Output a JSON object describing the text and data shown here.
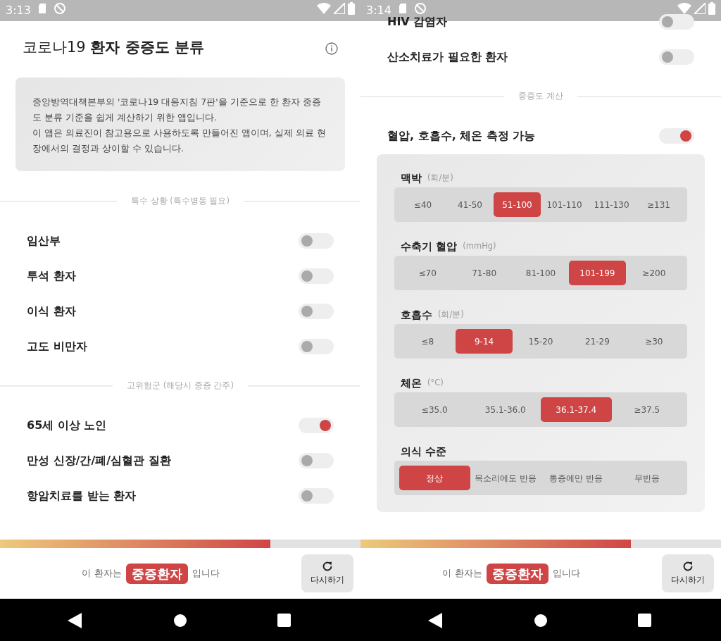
{
  "screens": [
    {
      "status_bar": {
        "time": "3:13"
      },
      "title": "코로나19 **환자 중증도 분류**",
      "notice": [
        "중앙방역대책본부의 '코로나19 대응지침 7판'을 기준으로 한 환자 중증도 분류 기준을 쉽게 계산하기 위한 앱입니다.",
        "이 앱은 의료진이 참고용으로 사용하도록 만들어진 앱이며, 실제 의료 현장에서의 결정과 상이할 수 있습니다."
      ],
      "sections": [
        {
          "kind": "divider",
          "label": "특수 상황 (특수병동 필요)"
        },
        {
          "kind": "toggle",
          "label": "임산부",
          "on": false
        },
        {
          "kind": "toggle",
          "label": "투석 환자",
          "on": false
        },
        {
          "kind": "toggle",
          "label": "이식 환자",
          "on": false
        },
        {
          "kind": "toggle",
          "label": "고도 비만자",
          "on": false
        },
        {
          "kind": "divider",
          "label": "고위험군 (해당시 중증 간주)"
        },
        {
          "kind": "toggle",
          "label": "65세 이상 노인",
          "on": true
        },
        {
          "kind": "toggle",
          "label": "만성 신장/간/폐/심혈관 질환",
          "on": false
        },
        {
          "kind": "toggle",
          "label": "항암치료를 받는 환자",
          "on": false
        }
      ],
      "progress": {
        "level": 0.75
      },
      "result": {
        "prefix": "이 환자는",
        "badge": "중증환자",
        "suffix": "입니다"
      },
      "reset_button": "다시하기"
    },
    {
      "status_bar": {
        "time": "3:14"
      },
      "sections": [
        {
          "kind": "toggle",
          "label": "HIV 감염자",
          "on": false
        },
        {
          "kind": "toggle",
          "label": "산소치료가 필요한 환자",
          "on": false
        },
        {
          "kind": "divider",
          "label": "중증도 계산"
        },
        {
          "kind": "toggle",
          "label": "혈압, 호흡수, 체온 측정 가능",
          "on": true
        },
        {
          "kind": "panel",
          "groups": [
            {
              "label": "맥박",
              "unit": "(회/분)",
              "options": [
                {
                  "label": "≤40",
                  "selected": false
                },
                {
                  "label": "41-50",
                  "selected": false
                },
                {
                  "label": "51-100",
                  "selected": true
                },
                {
                  "label": "101-110",
                  "selected": false
                },
                {
                  "label": "111-130",
                  "selected": false
                },
                {
                  "label": "≥131",
                  "selected": false
                }
              ]
            },
            {
              "label": "수축기 혈압",
              "unit": "(mmHg)",
              "options": [
                {
                  "label": "≤70",
                  "selected": false
                },
                {
                  "label": "71-80",
                  "selected": false
                },
                {
                  "label": "81-100",
                  "selected": false
                },
                {
                  "label": "101-199",
                  "selected": true
                },
                {
                  "label": "≥200",
                  "selected": false
                }
              ]
            },
            {
              "label": "호흡수",
              "unit": "(회/분)",
              "options": [
                {
                  "label": "≤8",
                  "selected": false
                },
                {
                  "label": "9-14",
                  "selected": true
                },
                {
                  "label": "15-20",
                  "selected": false
                },
                {
                  "label": "21-29",
                  "selected": false
                },
                {
                  "label": "≥30",
                  "selected": false
                }
              ]
            },
            {
              "label": "체온",
              "unit": "(°C)",
              "options": [
                {
                  "label": "≤35.0",
                  "selected": false
                },
                {
                  "label": "35.1-36.0",
                  "selected": false
                },
                {
                  "label": "36.1-37.4",
                  "selected": true
                },
                {
                  "label": "≥37.5",
                  "selected": false
                }
              ]
            },
            {
              "label": "의식 수준",
              "options": [
                {
                  "label": "정상",
                  "selected": true
                },
                {
                  "label": "목소리에도 반응",
                  "selected": false
                },
                {
                  "label": "통증에만 반응",
                  "selected": false
                },
                {
                  "label": "무반응",
                  "selected": false
                }
              ]
            }
          ]
        }
      ],
      "progress": {
        "level": 0.75
      },
      "result": {
        "prefix": "이 환자는",
        "badge": "중증환자",
        "suffix": "입니다"
      },
      "reset_button": "다시하기"
    }
  ]
}
